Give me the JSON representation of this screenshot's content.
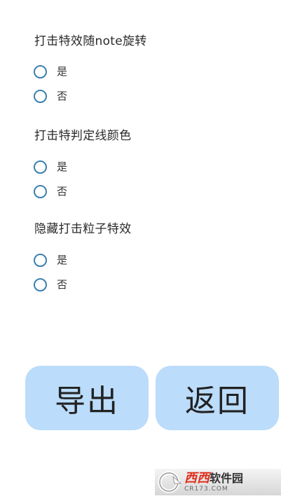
{
  "groups": [
    {
      "title": "打击特效随note旋转",
      "options": [
        {
          "label": "是"
        },
        {
          "label": "否"
        }
      ]
    },
    {
      "title": "打击特判定线颜色",
      "options": [
        {
          "label": "是"
        },
        {
          "label": "否"
        }
      ]
    },
    {
      "title": "隐藏打击粒子特效",
      "options": [
        {
          "label": "是"
        },
        {
          "label": "否"
        }
      ]
    }
  ],
  "buttons": {
    "export_label": "导出",
    "back_label": "返回"
  },
  "watermark": {
    "name_red": "西西",
    "name_black": "软件园",
    "domain": "CR173.COM"
  },
  "colors": {
    "radio_border": "#3b7fae",
    "button_bg": "#bbdcfb",
    "watermark_red": "#e0301e"
  }
}
